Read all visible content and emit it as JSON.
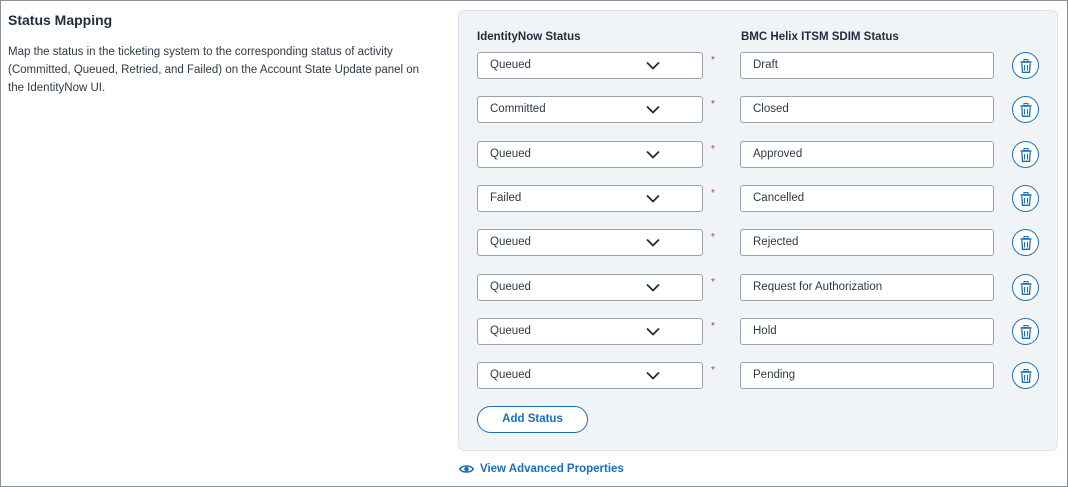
{
  "section": {
    "title": "Status Mapping",
    "description": "Map the status in the ticketing system to the corresponding status of activity (Committed, Queued, Retried, and Failed) on the Account State Update panel on the IdentityNow UI."
  },
  "mapping": {
    "col_identitynow": "IdentityNow Status",
    "col_bmc": "BMC Helix ITSM SDIM Status",
    "required_mark": "*",
    "rows": [
      {
        "identitynow": "Queued",
        "bmc": "Draft"
      },
      {
        "identitynow": "Committed",
        "bmc": "Closed"
      },
      {
        "identitynow": "Queued",
        "bmc": "Approved"
      },
      {
        "identitynow": "Failed",
        "bmc": "Cancelled"
      },
      {
        "identitynow": "Queued",
        "bmc": "Rejected"
      },
      {
        "identitynow": "Queued",
        "bmc": "Request for Authorization"
      },
      {
        "identitynow": "Queued",
        "bmc": "Hold"
      },
      {
        "identitynow": "Queued",
        "bmc": "Pending"
      }
    ],
    "add_label": "Add Status"
  },
  "advanced_link": "View Advanced Properties",
  "colors": {
    "accent": "#1b6fb8",
    "required": "#d0312d",
    "panel_bg": "#f1f4f7"
  },
  "icons": {
    "dropdown": "chevron-down-icon",
    "delete": "trash-icon",
    "advanced": "eye-icon"
  }
}
